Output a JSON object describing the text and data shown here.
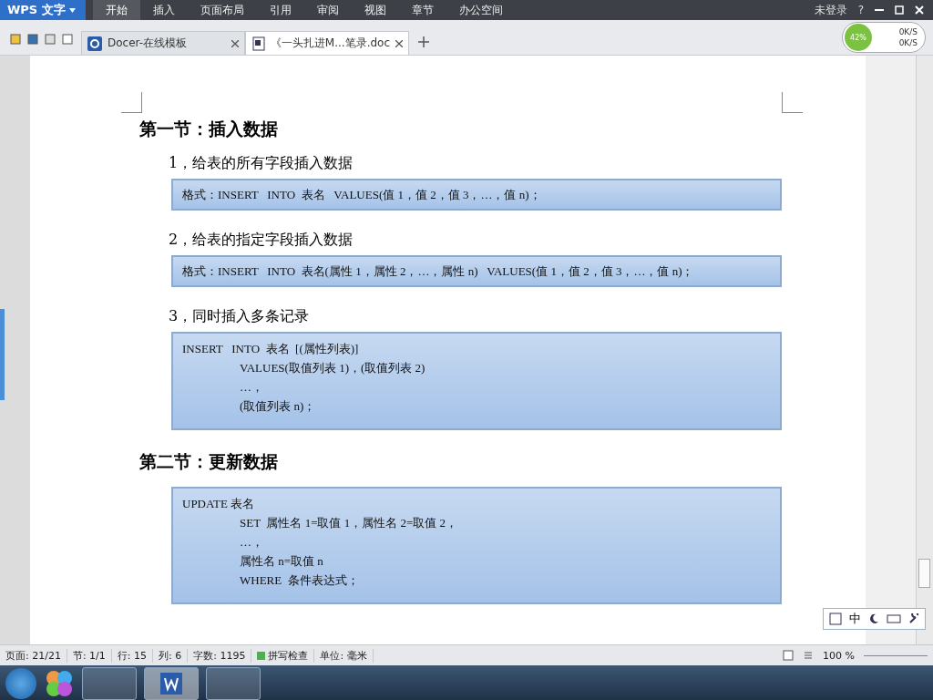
{
  "app": {
    "name": "WPS 文字",
    "menu": [
      {
        "label": "开始",
        "selected": true
      },
      {
        "label": "插入",
        "selected": false
      },
      {
        "label": "页面布局",
        "selected": false
      },
      {
        "label": "引用",
        "selected": false
      },
      {
        "label": "审阅",
        "selected": false
      },
      {
        "label": "视图",
        "selected": false
      },
      {
        "label": "章节",
        "selected": false
      },
      {
        "label": "办公空间",
        "selected": false
      }
    ],
    "login": "未登录",
    "help": "?"
  },
  "tabs": [
    {
      "kind": "docer",
      "label": "Docer-在线模板",
      "selected": false
    },
    {
      "kind": "doc",
      "label": "《一头扎进M...笔录.doc",
      "selected": true
    }
  ],
  "speed": {
    "percent": "42%",
    "up": "0K/S",
    "down": "0K/S"
  },
  "document": {
    "sections": [
      {
        "heading": "第一节：插入数据",
        "items": [
          {
            "kind": "subheading",
            "text": "1，给表的所有字段插入数据"
          },
          {
            "kind": "codebox",
            "lines": [
              "格式：INSERT   INTO  表名   VALUES(值 1，值 2，值 3，…，值 n)；"
            ]
          },
          {
            "kind": "subheading",
            "text": "2，给表的指定字段插入数据"
          },
          {
            "kind": "codebox",
            "lines": [
              "格式：INSERT   INTO  表名(属性 1，属性 2，…，属性 n)   VALUES(值 1，值 2，值 3，…，值 n)；"
            ]
          },
          {
            "kind": "subheading",
            "text": "3，同时插入多条记录"
          },
          {
            "kind": "codebox",
            "lines": [
              "INSERT   INTO  表名  [(属性列表)]",
              "VALUES(取值列表 1)，(取值列表 2)",
              "…，",
              "(取值列表 n)；"
            ]
          }
        ]
      },
      {
        "heading": "第二节：更新数据",
        "items": [
          {
            "kind": "codebox",
            "lines": [
              "UPDATE 表名",
              "SET  属性名 1=取值 1，属性名 2=取值 2，",
              "…，",
              "属性名 n=取值 n",
              "WHERE  条件表达式；"
            ]
          }
        ]
      }
    ]
  },
  "ime": {
    "label": "中"
  },
  "status": {
    "items": [
      "页面: 21/21",
      "节: 1/1",
      "行: 15",
      "列: 6",
      "字数: 1195"
    ],
    "spell": {
      "label": "拼写检查",
      "on": true
    },
    "unit": "单位: 毫米",
    "zoom": "100 %"
  }
}
